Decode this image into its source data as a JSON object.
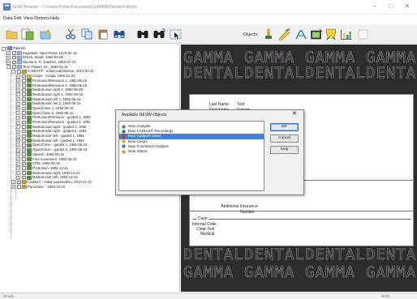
{
  "window": {
    "title": "GSW Browser - C:\\Users\\Public\\Documents\\GAMMA\\Dental\\Patients"
  },
  "menu": [
    "Data",
    "Edit",
    "View",
    "Options",
    "Help"
  ],
  "toolbar": {
    "objects_label": "Objects:",
    "buttons_left": [
      "open-folder-icon",
      "new-patient-icon",
      "import-icon",
      "cut-icon",
      "copy-icon",
      "paste-icon",
      "binoculars-icon",
      "find-icon",
      "find-next-icon",
      "select-icon"
    ],
    "buttons_objects": [
      "jaw-object-icon",
      "pencil-object-icon",
      "instrument-object-icon",
      "camera-object-icon",
      "tooth-object-icon",
      "chart-object-icon",
      "blank-object-icon"
    ]
  },
  "tree": {
    "items": [
      {
        "depth": 0,
        "label": "Patients",
        "icon": "patients-folder-icon",
        "expander": "-"
      },
      {
        "depth": 1,
        "label": "Kugelwitz, Hans-Peter, 1978-02-16",
        "icon": "patient-icon",
        "expander": "+"
      },
      {
        "depth": 1,
        "label": "Check, Steak, 1960-06-06",
        "icon": "patient-icon",
        "expander": "+"
      },
      {
        "depth": 1,
        "label": "Niemann, H. Joachim, 1953-07-31",
        "icon": "patient-icon",
        "expander": "+"
      },
      {
        "depth": 1,
        "label": "Test, Patient, Dr., 1983-01-31",
        "icon": "patient-icon",
        "expander": "-"
      },
      {
        "depth": 2,
        "label": "CADIAX® - Initial examination, 2014-02-21",
        "icon": "cadiax-icon",
        "expander": "-"
      },
      {
        "depth": 3,
        "label": "Cusps - Cusps, 1992-12-21",
        "icon": "cusps-icon",
        "expander": "+"
      },
      {
        "depth": 3,
        "label": "Protrusion/Retrusion 1, 1992-05-15",
        "icon": "record-icon",
        "expander": "+"
      },
      {
        "depth": 3,
        "label": "Protrusion/Retrusion 2, 1992-05-15",
        "icon": "record-icon",
        "expander": "+"
      },
      {
        "depth": 3,
        "label": "Mediotrusion right 1, 1992-05-15",
        "icon": "record-icon",
        "expander": "+"
      },
      {
        "depth": 3,
        "label": "Mediotrusion right 2, 1992-05-15",
        "icon": "record-icon",
        "expander": "+"
      },
      {
        "depth": 3,
        "label": "Mediotrusion left 1, 1992-05-15",
        "icon": "record-icon",
        "expander": "+"
      },
      {
        "depth": 3,
        "label": "Mediotrusion left 2, 1992-05-15",
        "icon": "record-icon",
        "expander": "+"
      },
      {
        "depth": 3,
        "label": "Open/Close 1, 1992-05-15",
        "icon": "record-icon",
        "expander": "+"
      },
      {
        "depth": 3,
        "label": "Open/Close 2, 1992-05-15",
        "icon": "record-icon",
        "expander": "+"
      },
      {
        "depth": 3,
        "label": "Protrusion/Retrusion - guided 1, 1992",
        "icon": "record-icon",
        "expander": "+"
      },
      {
        "depth": 3,
        "label": "Protrusion/Retrusion - guided 2, 1992",
        "icon": "record-icon",
        "expander": "+"
      },
      {
        "depth": 3,
        "label": "Mediotrusion right - guided 1, 1992",
        "icon": "record-icon",
        "expander": "+"
      },
      {
        "depth": 3,
        "label": "Mediotrusion right - guided 2, 1992",
        "icon": "record-icon",
        "expander": "+"
      },
      {
        "depth": 3,
        "label": "Mediotrusion left - guided 1, 1992",
        "icon": "record-icon",
        "expander": "+"
      },
      {
        "depth": 3,
        "label": "Mediotrusion left - guided 2, 1992",
        "icon": "record-icon",
        "expander": "+"
      },
      {
        "depth": 3,
        "label": "Open/Close - guided 1, 1992-05-15",
        "icon": "record-icon",
        "expander": "+"
      },
      {
        "depth": 3,
        "label": "Open/Close - guided 2, 1992-05-15",
        "icon": "record-icon",
        "expander": "+"
      },
      {
        "depth": 3,
        "label": "Speech, 1992-05-15",
        "icon": "record-icon",
        "expander": "+"
      },
      {
        "depth": 3,
        "label": "Free movement, 1992-05-15",
        "icon": "record-icon",
        "expander": "+"
      },
      {
        "depth": 3,
        "label": "CPM, 1992-05-15",
        "icon": "record-icon",
        "expander": "+"
      },
      {
        "depth": 3,
        "label": "Protrusion, 1992-12-21",
        "icon": "record-icon",
        "expander": "+"
      },
      {
        "depth": 3,
        "label": "Mediotrusion right, 1992-12-21",
        "icon": "record-icon",
        "expander": "+"
      },
      {
        "depth": 3,
        "label": "Mediotrusion left, 1992-12-21",
        "icon": "record-icon",
        "expander": "+"
      },
      {
        "depth": 2,
        "label": "Cadiax® - Initial examination, 2014-01-31",
        "icon": "cadiax-icon",
        "expander": "+"
      },
      {
        "depth": 2,
        "label": "Panoramic - 1993-12-20",
        "icon": "status-icon",
        "expander": "+"
      }
    ]
  },
  "watermark": {
    "line1": "GAMMA",
    "line2": "DENTAL"
  },
  "card": {
    "last_name_label": "Last Name",
    "last_name_value": "Test",
    "first_name_label": "First Name",
    "first_name_value": "Patient",
    "insurance_label_1": "Additional Insurance",
    "insurance_label_2": "Number",
    "case_group": "Case",
    "internal_code_label": "Internal Code",
    "clear_text_label": "Clear Text",
    "medical_label": "Medical"
  },
  "dialog": {
    "title": "Available GESW Objects",
    "close": "✕",
    "items": [
      {
        "label": "New Analysis",
        "icon": "analysis-icon",
        "selected": false
      },
      {
        "label": "New CADIAX® Recordings",
        "icon": "cadiax-recording-icon",
        "selected": false
      },
      {
        "label": "New Cadiax® Steer",
        "icon": "cadiax-steer-icon",
        "selected": true
      },
      {
        "label": "New Cusps",
        "icon": "cusps-icon",
        "selected": false
      },
      {
        "label": "New Functional Analysis",
        "icon": "functional-analysis-icon",
        "selected": false
      },
      {
        "label": "New Status",
        "icon": "status-icon",
        "selected": false
      }
    ],
    "ok_label": "OK",
    "cancel_label": "Cancel",
    "help_label": "Help"
  },
  "status": {
    "left": "Ready",
    "right": "NUM"
  },
  "colors": {
    "selection": "#3f83d9",
    "panel_background": "#2c2c2c",
    "watermark_stroke": "#8a8a8a"
  }
}
